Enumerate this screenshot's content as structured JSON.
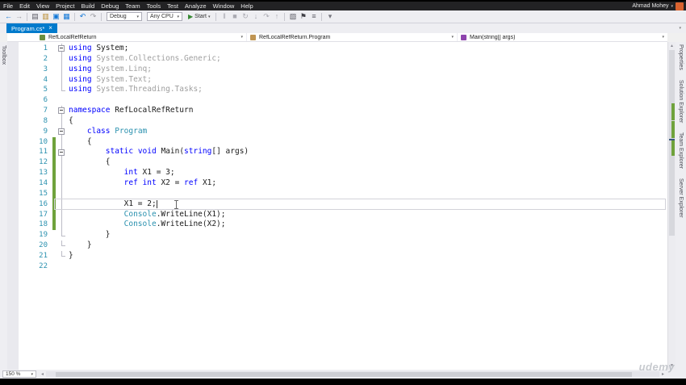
{
  "window": {
    "menu": [
      "File",
      "Edit",
      "View",
      "Project",
      "Build",
      "Debug",
      "Team",
      "Tools",
      "Test",
      "Analyze",
      "Window",
      "Help"
    ],
    "user": "Ahmad Mohey"
  },
  "glyphs": {
    "caret_down": "▾",
    "close": "×",
    "up": "▲",
    "down": "▼",
    "left": "◂",
    "right": "▸"
  },
  "toolbar": {
    "items": [
      {
        "type": "icon",
        "name": "nav-back-icon",
        "glyph": "←",
        "color": "#1177d7"
      },
      {
        "type": "icon",
        "name": "nav-forward-icon",
        "glyph": "→",
        "color": "#9a9aa0"
      },
      {
        "type": "sep"
      },
      {
        "type": "icon",
        "name": "new-file-icon",
        "glyph": "▤",
        "color": "#5b5b64"
      },
      {
        "type": "icon",
        "name": "open-file-icon",
        "glyph": "▥",
        "color": "#b98a2f"
      },
      {
        "type": "icon",
        "name": "save-icon",
        "glyph": "▣",
        "color": "#1177d7"
      },
      {
        "type": "icon",
        "name": "save-all-icon",
        "glyph": "▦",
        "color": "#1177d7"
      },
      {
        "type": "sep"
      },
      {
        "type": "icon",
        "name": "undo-icon",
        "glyph": "↶",
        "color": "#1177d7"
      },
      {
        "type": "icon",
        "name": "redo-icon",
        "glyph": "↷",
        "color": "#9a9aa0"
      },
      {
        "type": "sep"
      },
      {
        "type": "combo",
        "name": "debug-configuration-dropdown",
        "label": "Debug"
      },
      {
        "type": "combo",
        "name": "platform-dropdown",
        "label": "Any CPU"
      },
      {
        "type": "start",
        "name": "start-debugging-button",
        "label": "Start"
      },
      {
        "type": "sep"
      },
      {
        "type": "icon",
        "name": "pause-icon",
        "glyph": "‖",
        "color": "#aaaab2"
      },
      {
        "type": "icon",
        "name": "stop-icon",
        "glyph": "■",
        "color": "#aaaab2"
      },
      {
        "type": "icon",
        "name": "restart-icon",
        "glyph": "↻",
        "color": "#aaaab2"
      },
      {
        "type": "icon",
        "name": "step-into-icon",
        "glyph": "↓",
        "color": "#aaaab2"
      },
      {
        "type": "icon",
        "name": "step-over-icon",
        "glyph": "↷",
        "color": "#aaaab2"
      },
      {
        "type": "icon",
        "name": "step-out-icon",
        "glyph": "↑",
        "color": "#aaaab2"
      },
      {
        "type": "sep"
      },
      {
        "type": "icon",
        "name": "find-icon",
        "glyph": "▧",
        "color": "#5b5b64"
      },
      {
        "type": "icon",
        "name": "bookmark-flag-icon",
        "glyph": "⚑",
        "color": "#3f3f46"
      },
      {
        "type": "icon",
        "name": "comment-lines-icon",
        "glyph": "≡",
        "color": "#5b5b64"
      },
      {
        "type": "sep"
      },
      {
        "type": "icon",
        "name": "toolbar-overflow-icon",
        "glyph": "▾",
        "color": "#77777f"
      }
    ]
  },
  "tabs": [
    {
      "label": "Program.cs*"
    }
  ],
  "navbar": {
    "project_label": "RefLocalRefReturn",
    "type_label": "RefLocalRefReturn.Program",
    "member_label": "Main(string[] args)"
  },
  "side_tabs_left": [
    "Toolbox"
  ],
  "side_tabs_right": [
    "Properties",
    "Solution Explorer",
    "Team Explorer",
    "Server Explorer"
  ],
  "statusbar": {
    "zoom": "150 %"
  },
  "watermark": "udemy",
  "colors": {
    "accent_blue": "#007acc",
    "keyword": "#0000ff",
    "type_name": "#2b91af",
    "inactive_code": "#9f9f9f",
    "change_track_green": "#6fa23c",
    "avatar_orange": "#d9632f"
  },
  "editor": {
    "current_line": 16,
    "lines": [
      {
        "n": 1,
        "fold": "box",
        "chg": "",
        "toks": [
          [
            "k",
            "using"
          ],
          [
            "pl",
            " System;"
          ]
        ]
      },
      {
        "n": 2,
        "fold": "line",
        "chg": "",
        "toks": [
          [
            "k",
            "using"
          ],
          [
            "g",
            " System.Collections.Generic;"
          ]
        ]
      },
      {
        "n": 3,
        "fold": "line",
        "chg": "",
        "toks": [
          [
            "k",
            "using"
          ],
          [
            "g",
            " System.Linq;"
          ]
        ]
      },
      {
        "n": 4,
        "fold": "line",
        "chg": "",
        "toks": [
          [
            "k",
            "using"
          ],
          [
            "g",
            " System.Text;"
          ]
        ]
      },
      {
        "n": 5,
        "fold": "end",
        "chg": "",
        "toks": [
          [
            "k",
            "using"
          ],
          [
            "g",
            " System.Threading.Tasks;"
          ]
        ]
      },
      {
        "n": 6,
        "fold": "",
        "chg": "",
        "toks": []
      },
      {
        "n": 7,
        "fold": "box",
        "chg": "",
        "toks": [
          [
            "k",
            "namespace"
          ],
          [
            "pl",
            " RefLocalRefReturn"
          ]
        ]
      },
      {
        "n": 8,
        "fold": "line",
        "chg": "",
        "toks": [
          [
            "pl",
            "{"
          ]
        ]
      },
      {
        "n": 9,
        "fold": "box",
        "chg": "",
        "toks": [
          [
            "pl",
            "    "
          ],
          [
            "k",
            "class"
          ],
          [
            "pl",
            " "
          ],
          [
            "t",
            "Program"
          ]
        ]
      },
      {
        "n": 10,
        "fold": "line",
        "chg": "green",
        "toks": [
          [
            "pl",
            "    {"
          ]
        ]
      },
      {
        "n": 11,
        "fold": "box",
        "chg": "green",
        "toks": [
          [
            "pl",
            "        "
          ],
          [
            "k",
            "static"
          ],
          [
            "pl",
            " "
          ],
          [
            "k",
            "void"
          ],
          [
            "pl",
            " Main("
          ],
          [
            "k",
            "string"
          ],
          [
            "pl",
            "[] args)"
          ]
        ]
      },
      {
        "n": 12,
        "fold": "line",
        "chg": "green",
        "toks": [
          [
            "pl",
            "        {"
          ]
        ]
      },
      {
        "n": 13,
        "fold": "line",
        "chg": "green",
        "toks": [
          [
            "pl",
            "            "
          ],
          [
            "k",
            "int"
          ],
          [
            "pl",
            " X1 = 3;"
          ]
        ]
      },
      {
        "n": 14,
        "fold": "line",
        "chg": "green",
        "toks": [
          [
            "pl",
            "            "
          ],
          [
            "k",
            "ref"
          ],
          [
            "pl",
            " "
          ],
          [
            "k",
            "int"
          ],
          [
            "pl",
            " X2 = "
          ],
          [
            "k",
            "ref"
          ],
          [
            "pl",
            " X1;"
          ]
        ]
      },
      {
        "n": 15,
        "fold": "line",
        "chg": "green",
        "toks": []
      },
      {
        "n": 16,
        "fold": "line",
        "chg": "green",
        "toks": [
          [
            "pl",
            "            X1 = 2;"
          ]
        ]
      },
      {
        "n": 17,
        "fold": "line",
        "chg": "green",
        "toks": [
          [
            "pl",
            "            "
          ],
          [
            "t",
            "Console"
          ],
          [
            "pl",
            ".WriteLine(X1);"
          ]
        ]
      },
      {
        "n": 18,
        "fold": "line",
        "chg": "green",
        "toks": [
          [
            "pl",
            "            "
          ],
          [
            "t",
            "Console"
          ],
          [
            "pl",
            ".WriteLine(X2);"
          ]
        ]
      },
      {
        "n": 19,
        "fold": "end",
        "chg": "",
        "toks": [
          [
            "pl",
            "        }"
          ]
        ]
      },
      {
        "n": 20,
        "fold": "end",
        "chg": "",
        "toks": [
          [
            "pl",
            "    }"
          ]
        ]
      },
      {
        "n": 21,
        "fold": "end",
        "chg": "",
        "toks": [
          [
            "pl",
            "}"
          ]
        ]
      },
      {
        "n": 22,
        "fold": "",
        "chg": "",
        "toks": []
      }
    ]
  }
}
